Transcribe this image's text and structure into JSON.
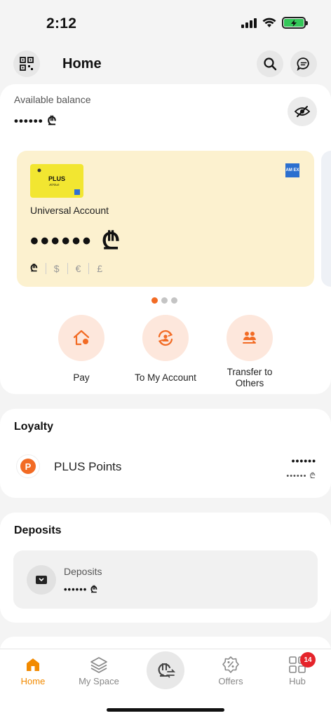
{
  "status": {
    "time": "2:12"
  },
  "header": {
    "title": "Home"
  },
  "balance": {
    "label": "Available balance",
    "value": "•••••• ₾"
  },
  "account_card": {
    "card_brand": "PLUS",
    "card_sub": "ᲞᲚᲣᲡᲘ",
    "name": "Universal Account",
    "balance": "•••••• ₾",
    "currencies": [
      "₾",
      "$",
      "€",
      "£"
    ],
    "amex_text": "AM EX"
  },
  "carousel": {
    "count": 3,
    "active_index": 0
  },
  "actions": [
    {
      "label": "Pay",
      "icon": "pay-home-icon"
    },
    {
      "label": "To My Account",
      "icon": "transfer-self-icon"
    },
    {
      "label": "Transfer to Others",
      "icon": "transfer-others-icon"
    }
  ],
  "loyalty": {
    "title": "Loyalty",
    "item": {
      "name": "PLUS Points",
      "value": "••••••",
      "sub_value": "•••••• ₾",
      "icon_letter": "P"
    }
  },
  "deposits": {
    "title": "Deposits",
    "item": {
      "name": "Deposits",
      "value": "•••••• ₾"
    }
  },
  "nav": {
    "items": [
      {
        "label": "Home",
        "icon": "home-icon",
        "active": true
      },
      {
        "label": "My Space",
        "icon": "layers-icon"
      },
      {
        "label": "",
        "icon": "currency-exchange-icon"
      },
      {
        "label": "Offers",
        "icon": "discount-badge-icon"
      },
      {
        "label": "Hub",
        "icon": "grid-icon",
        "badge": "14"
      }
    ]
  },
  "colors": {
    "accent": "#f26b24",
    "card_bg": "#fcf1cf",
    "nav_active": "#f28a00",
    "badge": "#e5242b"
  }
}
